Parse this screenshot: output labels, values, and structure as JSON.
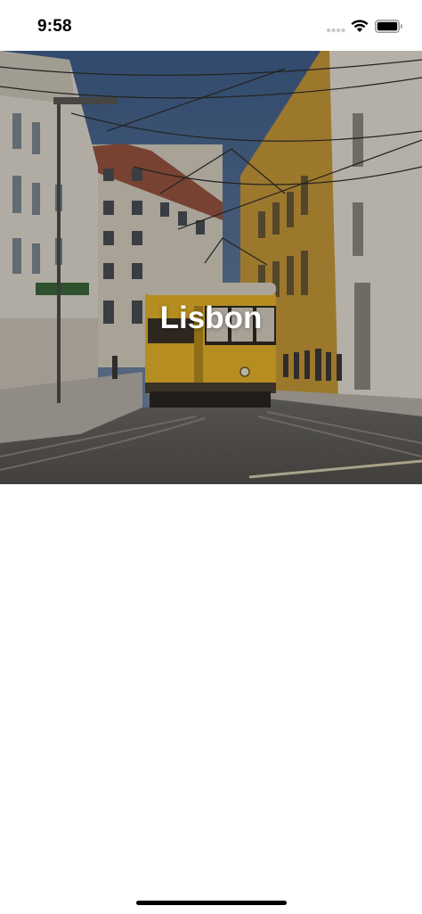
{
  "status_bar": {
    "time": "9:58",
    "icons": [
      "signal-icon",
      "wifi-icon",
      "battery-icon"
    ]
  },
  "hero": {
    "title": "Lisbon",
    "image": "tram-street-photo",
    "title_color": "#ffffff"
  },
  "colors": {
    "tram_yellow": "#e8b52a",
    "sky": "#4a6790",
    "background": "#ffffff"
  }
}
